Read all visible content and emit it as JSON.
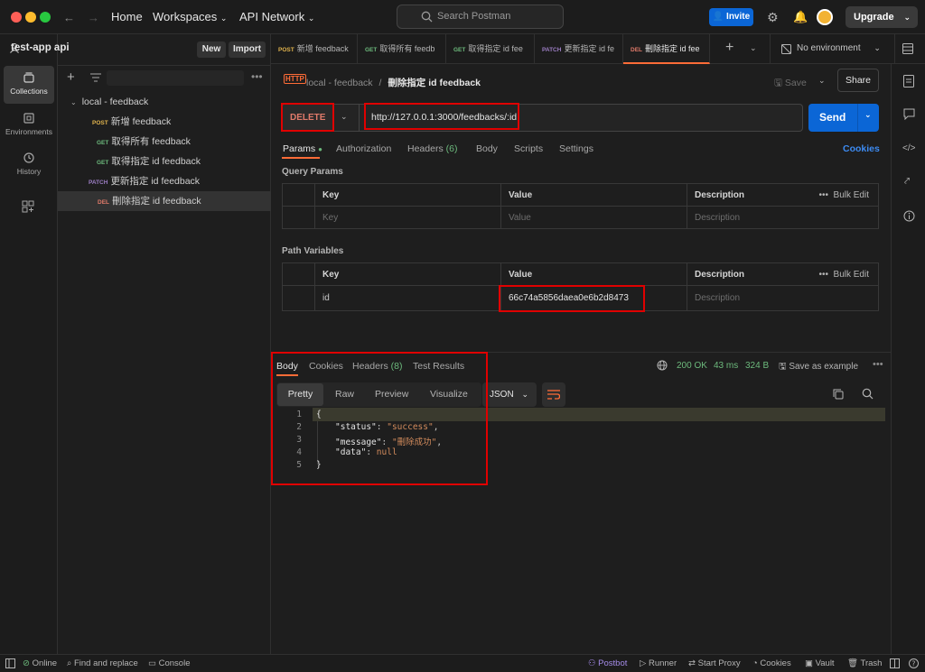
{
  "titlebar": {
    "home": "Home",
    "workspaces": "Workspaces",
    "api_network": "API Network",
    "search_placeholder": "Search Postman",
    "invite": "Invite",
    "upgrade": "Upgrade"
  },
  "rail": {
    "collections": "Collections",
    "environments": "Environments",
    "history": "History"
  },
  "sidebar": {
    "workspace_name": "test-app api",
    "new_label": "New",
    "import_label": "Import",
    "folder": "local - feedback",
    "items": [
      {
        "method": "POST",
        "name": "新增 feedback"
      },
      {
        "method": "GET",
        "name": "取得所有 feedback"
      },
      {
        "method": "GET",
        "name": "取得指定 id feedback"
      },
      {
        "method": "PATCH",
        "name": "更新指定 id feedback"
      },
      {
        "method": "DEL",
        "name": "刪除指定 id feedback"
      }
    ]
  },
  "tabs": [
    {
      "method": "POST",
      "name": "新增 feedback"
    },
    {
      "method": "GET",
      "name": "取得所有 feedb"
    },
    {
      "method": "GET",
      "name": "取得指定 id fee"
    },
    {
      "method": "PATCH",
      "name": "更新指定 id fe"
    },
    {
      "method": "DEL",
      "name": "刪除指定 id fee"
    }
  ],
  "env": "No environment",
  "request": {
    "crumb_parent": "local - feedback",
    "crumb_sep": "/",
    "title": "刪除指定 id feedback",
    "save": "Save",
    "share": "Share",
    "method": "DELETE",
    "url": "http://127.0.0.1:3000/feedbacks/:id",
    "send": "Send",
    "subtabs": [
      "Params",
      "Authorization",
      "Headers",
      "(6)",
      "Body",
      "Scripts",
      "Settings"
    ],
    "cookies": "Cookies",
    "query_params_title": "Query Params",
    "path_variables_title": "Path Variables",
    "col_key": "Key",
    "col_value": "Value",
    "col_desc": "Description",
    "bulk_edit": "Bulk Edit",
    "ph_key": "Key",
    "ph_value": "Value",
    "ph_desc": "Description",
    "path_key": "id",
    "path_value": "66c74a5856daea0e6b2d8473"
  },
  "response": {
    "tabs": [
      "Body",
      "Cookies",
      "Headers",
      "(8)",
      "Test Results"
    ],
    "status": "200 OK",
    "time": "43 ms",
    "size": "324 B",
    "save_example": "Save as example",
    "formats": [
      "Pretty",
      "Raw",
      "Preview",
      "Visualize"
    ],
    "lang": "JSON",
    "lines": [
      "1",
      "2",
      "3",
      "4",
      "5"
    ],
    "code": {
      "open": "{",
      "k1": "\"status\"",
      "v1": "\"success\"",
      "k2": "\"message\"",
      "v2": "\"刪除成功\"",
      "k3": "\"data\"",
      "v3": "null",
      "close": "}"
    }
  },
  "statusbar": {
    "online": "Online",
    "find_replace": "Find and replace",
    "console": "Console",
    "postbot": "Postbot",
    "runner": "Runner",
    "start_proxy": "Start Proxy",
    "cookies": "Cookies",
    "vault": "Vault",
    "trash": "Trash"
  },
  "colors": {
    "accent": "#ff6c37",
    "send": "#0b66d6",
    "highlight_box": "#e00000",
    "status_ok": "#6cb97c"
  }
}
